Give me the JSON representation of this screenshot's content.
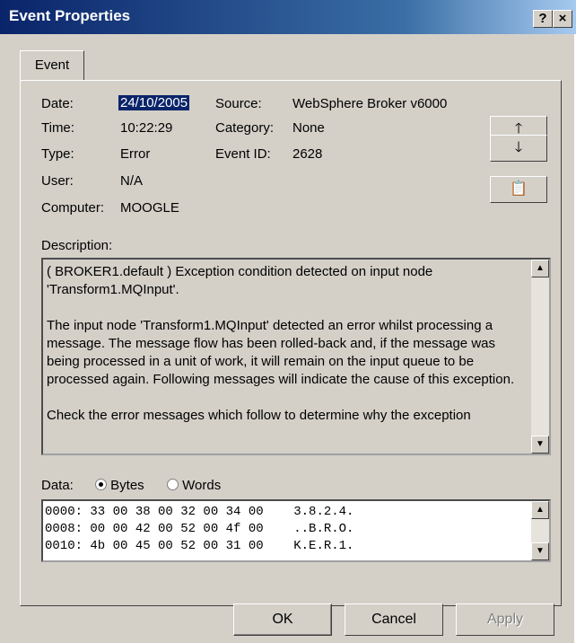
{
  "window": {
    "title": "Event Properties",
    "help_label": "?",
    "close_label": "×"
  },
  "tabs": [
    {
      "label": "Event"
    }
  ],
  "fields": {
    "date_label": "Date:",
    "date_value": "24/10/2005",
    "time_label": "Time:",
    "time_value": "10:22:29",
    "type_label": "Type:",
    "type_value": "Error",
    "user_label": "User:",
    "user_value": "N/A",
    "computer_label": "Computer:",
    "computer_value": "MOOGLE",
    "source_label": "Source:",
    "source_value": "WebSphere Broker v6000",
    "category_label": "Category:",
    "category_value": "None",
    "eventid_label": "Event ID:",
    "eventid_value": "2628"
  },
  "side_buttons": {
    "up_icon": "arrow-up-icon",
    "down_icon": "arrow-down-icon",
    "copy_icon": "copy-icon"
  },
  "description": {
    "label": "Description:",
    "paragraphs": [
      "( BROKER1.default ) Exception condition detected on input node 'Transform1.MQInput'.",
      "The input node 'Transform1.MQInput' detected an error whilst processing a message.  The message flow has been rolled-back and, if the message was being processed in a unit of work, it will remain on the input queue to be processed again.  Following messages will indicate the cause of this exception.",
      "Check the error messages which follow to determine why the exception"
    ]
  },
  "data": {
    "label": "Data:",
    "bytes_label": "Bytes",
    "words_label": "Words",
    "selected": "Bytes",
    "lines": [
      "0000: 33 00 38 00 32 00 34 00    3.8.2.4.",
      "0008: 00 00 42 00 52 00 4f 00    ..B.R.O.",
      "0010: 4b 00 45 00 52 00 31 00    K.E.R.1."
    ]
  },
  "buttons": {
    "ok": "OK",
    "cancel": "Cancel",
    "apply": "Apply"
  }
}
